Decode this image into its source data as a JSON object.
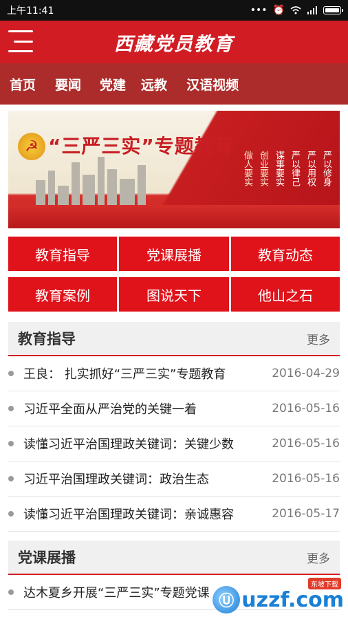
{
  "status_bar": {
    "time": "上午11:41"
  },
  "header": {
    "title": "西藏党员教育"
  },
  "nav": {
    "items": [
      "首页",
      "要闻",
      "党建",
      "远教",
      "汉语视频"
    ]
  },
  "banner": {
    "title": "“三严三实”专题教育",
    "slogans": [
      "做人要实",
      "创业要实",
      "谋事要实",
      "严以律己",
      "严以用权",
      "严以修身"
    ]
  },
  "grid": {
    "buttons": [
      "教育指导",
      "党课展播",
      "教育动态",
      "教育案例",
      "图说天下",
      "他山之石"
    ]
  },
  "sections": [
    {
      "title": "教育指导",
      "more": "更多",
      "items": [
        {
          "text": "王良： 扎实抓好“三严三实”专题教育",
          "date": "2016-04-29"
        },
        {
          "text": "习近平全面从严治党的关键一着",
          "date": "2016-05-16"
        },
        {
          "text": "读懂习近平治国理政关键词：关键少数",
          "date": "2016-05-16"
        },
        {
          "text": "习近平治国理政关键词：政治生态",
          "date": "2016-05-16"
        },
        {
          "text": "读懂习近平治国理政关键词：亲诚惠容",
          "date": "2016-05-17"
        }
      ]
    },
    {
      "title": "党课展播",
      "more": "更多",
      "items": [
        {
          "text": "达木夏乡开展“三严三实”专题党课",
          "date": ""
        }
      ]
    }
  ],
  "watermark": {
    "text": "uzzf.com",
    "badge": "东坡下载"
  },
  "colors": {
    "brand_red": "#d21c23",
    "nav_red": "#ab2c2a",
    "grid_red": "#e0121a"
  }
}
